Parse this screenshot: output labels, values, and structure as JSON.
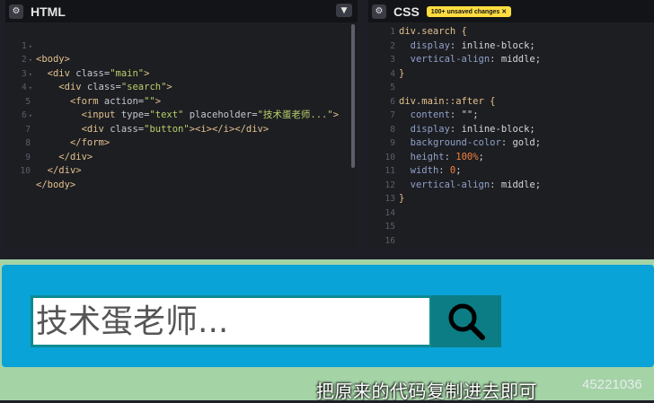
{
  "html_panel": {
    "title": "HTML",
    "lines": [
      {
        "n": "1",
        "fold": "▾"
      },
      {
        "n": "2",
        "fold": "▾"
      },
      {
        "n": "3",
        "fold": "▾"
      },
      {
        "n": "4",
        "fold": "▾"
      },
      {
        "n": "5",
        "fold": ""
      },
      {
        "n": "6",
        "fold": "▾"
      },
      {
        "n": "7",
        "fold": ""
      },
      {
        "n": "8",
        "fold": ""
      },
      {
        "n": "9",
        "fold": ""
      },
      {
        "n": "10",
        "fold": ""
      }
    ],
    "code": {
      "l1_tag": "<body>",
      "l2_open": "<div ",
      "l2_attr": "class=",
      "l2_str": "\"main\"",
      "l2_close": ">",
      "l3_open": "<div ",
      "l3_attr": "class=",
      "l3_str": "\"search\"",
      "l3_close": ">",
      "l4_open": "<form ",
      "l4_attr": "action=",
      "l4_str": "\"\"",
      "l4_close": ">",
      "l5_open": "<input ",
      "l5_attr1": "type=",
      "l5_str1": "\"text\"",
      "l5_attr2": " placeholder=",
      "l5_str2": "\"技术蛋老师...\"",
      "l5_close": ">",
      "l6_open": "<div ",
      "l6_attr": "class=",
      "l6_str": "\"button\"",
      "l6_close": "><i></i></div>",
      "l7_tag": "</form>",
      "l8_tag": "</div>",
      "l9_tag": "</div>",
      "l10_tag": "</body>"
    }
  },
  "css_panel": {
    "title": "CSS",
    "badge": "100+ unsaved changes ✕",
    "lines": [
      "1",
      "2",
      "3",
      "4",
      "5",
      "6",
      "7",
      "8",
      "9",
      "10",
      "11",
      "12",
      "13",
      "14",
      "15",
      "16"
    ],
    "code": {
      "l1_sel": "div.search {",
      "l2_prop": "display",
      "l2_val": "inline-block;",
      "l3_prop": "vertical-align",
      "l3_val": "middle;",
      "l4": "}",
      "l6_sel": "div.main::after {",
      "l7_prop": "content",
      "l7_val": "\"\";",
      "l8_prop": "display",
      "l8_val": "inline-block;",
      "l9_prop": "background-color",
      "l9_val": "gold;",
      "l10_prop": "height",
      "l10_val": "100%",
      "l10_semi": ";",
      "l11_prop": "width",
      "l11_val": "0",
      "l11_semi": ";",
      "l12_prop": "vertical-align",
      "l12_val": "middle;",
      "l13": "}"
    }
  },
  "result": {
    "search_placeholder": "技术蛋老师..."
  },
  "overlay": {
    "subtitle": "把原来的代码复制进去即可",
    "watermark": "45221036"
  },
  "colors": {
    "main_bg": "#0aa3d7",
    "button_bg": "#0c7d84",
    "result_bg": "#a4d3a6",
    "badge": "#ffdd40"
  }
}
